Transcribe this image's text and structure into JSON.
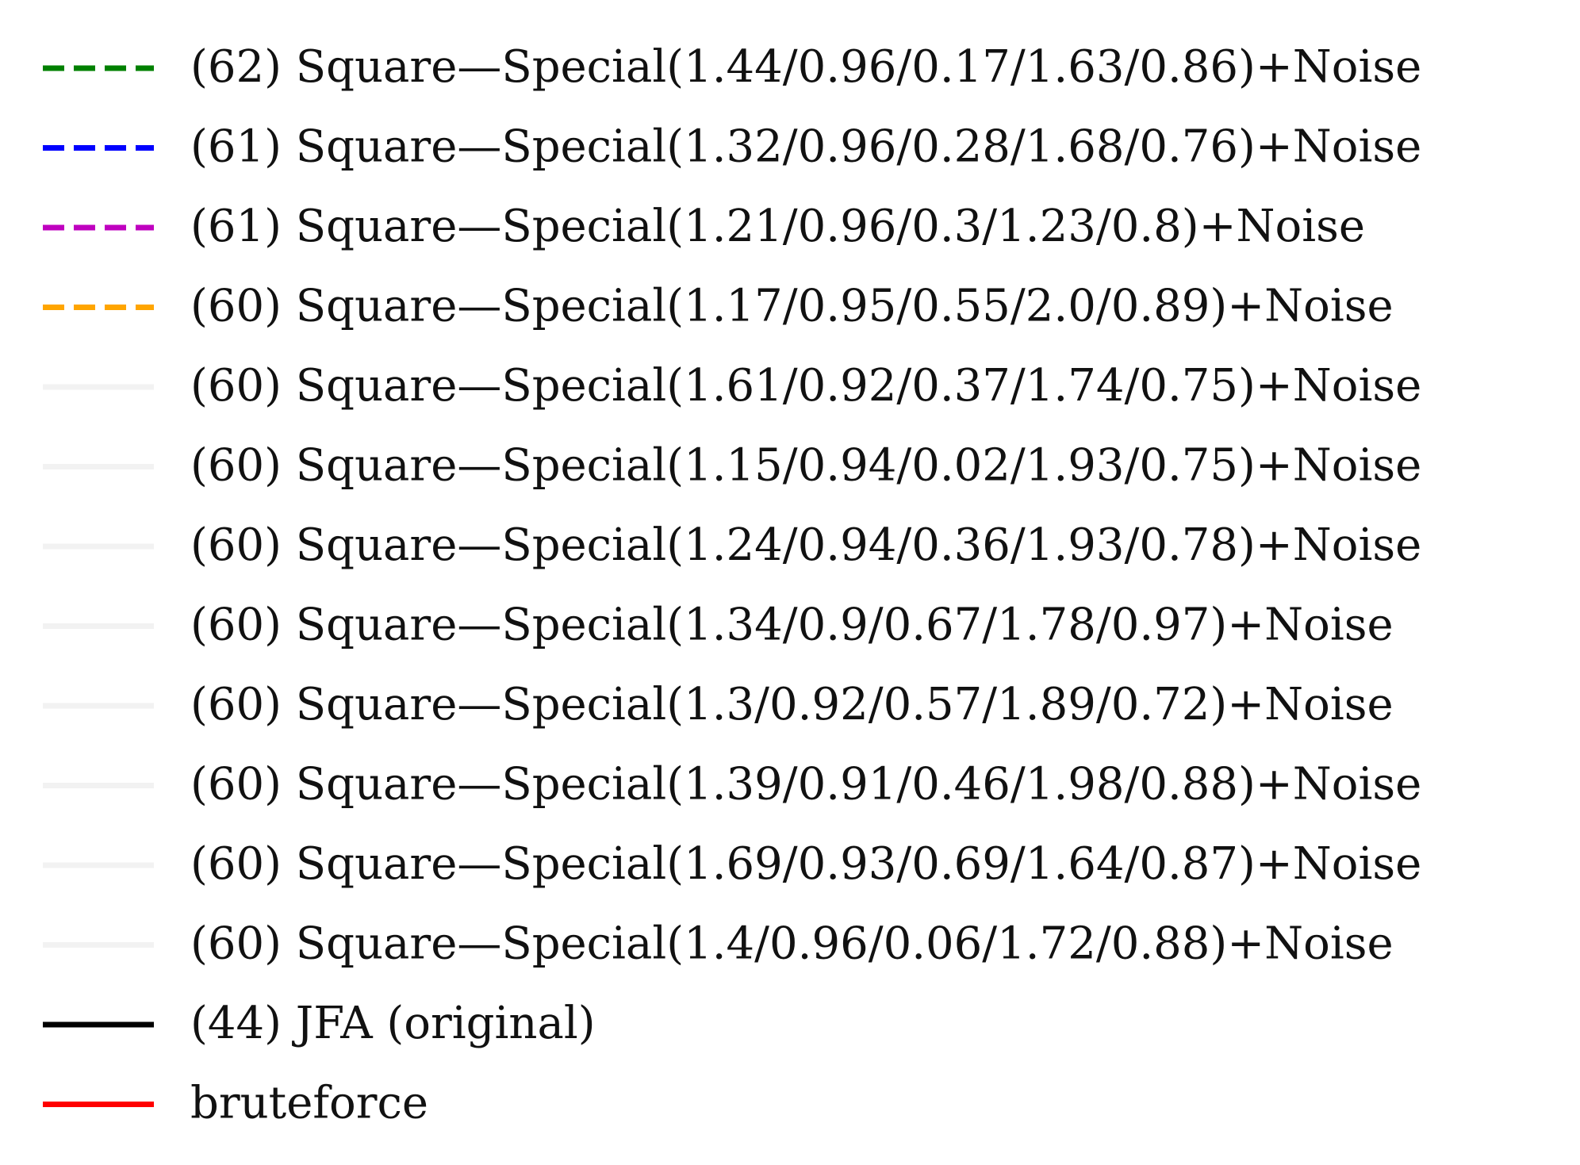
{
  "chart_data": {
    "type": "line",
    "component": "legend",
    "legend_entries": [
      {
        "label": "(62) Square—Special(1.44/0.96/0.17/1.63/0.86)+Noise",
        "color": "#008000",
        "style": "dashed"
      },
      {
        "label": "(61) Square—Special(1.32/0.96/0.28/1.68/0.76)+Noise",
        "color": "#0000ff",
        "style": "dashed"
      },
      {
        "label": "(61) Square—Special(1.21/0.96/0.3/1.23/0.8)+Noise",
        "color": "#bf00bf",
        "style": "dashed"
      },
      {
        "label": "(60) Square—Special(1.17/0.95/0.55/2.0/0.89)+Noise",
        "color": "#ffa500",
        "style": "dashed"
      },
      {
        "label": "(60) Square—Special(1.61/0.92/0.37/1.74/0.75)+Noise",
        "color": "#f2f2f2",
        "style": "solid"
      },
      {
        "label": "(60) Square—Special(1.15/0.94/0.02/1.93/0.75)+Noise",
        "color": "#f2f2f2",
        "style": "solid"
      },
      {
        "label": "(60) Square—Special(1.24/0.94/0.36/1.93/0.78)+Noise",
        "color": "#f2f2f2",
        "style": "solid"
      },
      {
        "label": "(60) Square—Special(1.34/0.9/0.67/1.78/0.97)+Noise",
        "color": "#f2f2f2",
        "style": "solid"
      },
      {
        "label": "(60) Square—Special(1.3/0.92/0.57/1.89/0.72)+Noise",
        "color": "#f2f2f2",
        "style": "solid"
      },
      {
        "label": "(60) Square—Special(1.39/0.91/0.46/1.98/0.88)+Noise",
        "color": "#f2f2f2",
        "style": "solid"
      },
      {
        "label": "(60) Square—Special(1.69/0.93/0.69/1.64/0.87)+Noise",
        "color": "#f2f2f2",
        "style": "solid"
      },
      {
        "label": "(60) Square—Special(1.4/0.96/0.06/1.72/0.88)+Noise",
        "color": "#f2f2f2",
        "style": "solid"
      },
      {
        "label": "(44) JFA (original)",
        "color": "#000000",
        "style": "solid"
      },
      {
        "label": "bruteforce",
        "color": "#ff0000",
        "style": "solid"
      }
    ]
  }
}
